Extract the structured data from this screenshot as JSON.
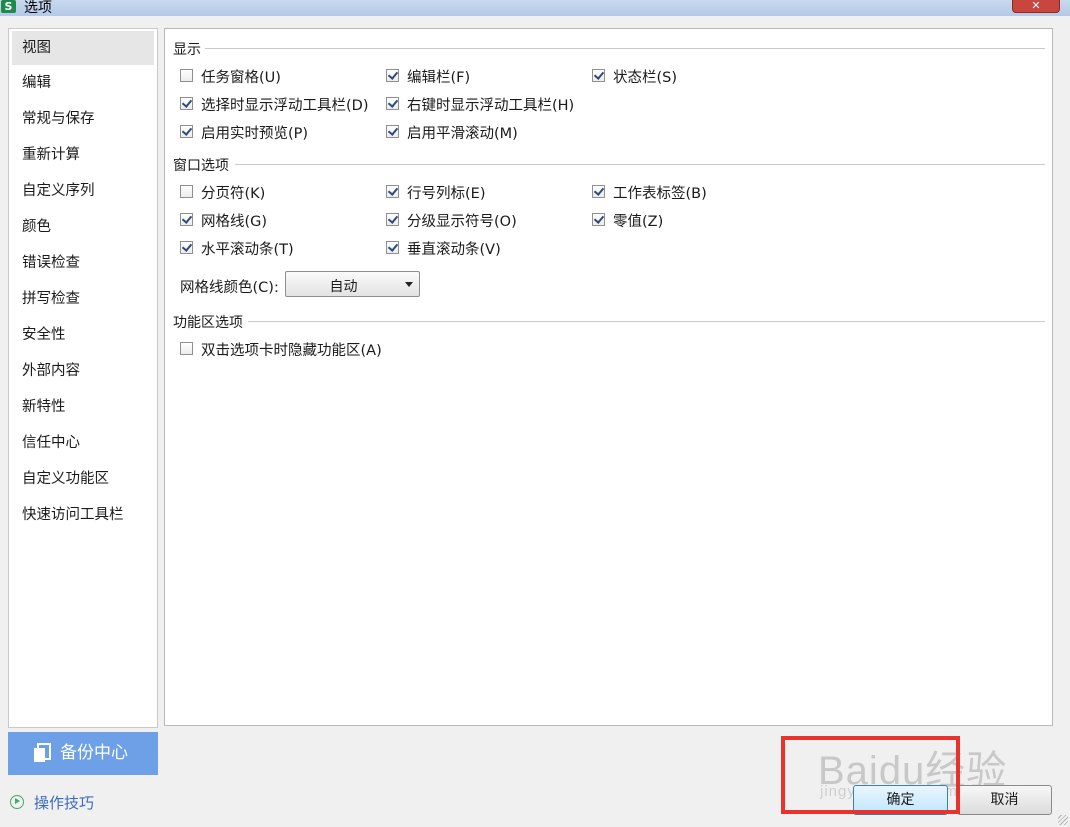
{
  "window": {
    "title": "选项",
    "app_icon": "S"
  },
  "sidebar": {
    "items": [
      {
        "label": "视图",
        "selected": true
      },
      {
        "label": "编辑"
      },
      {
        "label": "常规与保存"
      },
      {
        "label": "重新计算"
      },
      {
        "label": "自定义序列"
      },
      {
        "label": "颜色"
      },
      {
        "label": "错误检查"
      },
      {
        "label": "拼写检查"
      },
      {
        "label": "安全性"
      },
      {
        "label": "外部内容"
      },
      {
        "label": "新特性"
      },
      {
        "label": "信任中心"
      },
      {
        "label": "自定义功能区"
      },
      {
        "label": "快速访问工具栏"
      }
    ],
    "backup_label": "备份中心",
    "tips_label": "操作技巧"
  },
  "display": {
    "heading": "显示",
    "options": [
      {
        "label": "任务窗格(U)",
        "checked": false
      },
      {
        "label": "编辑栏(F)",
        "checked": true
      },
      {
        "label": "状态栏(S)",
        "checked": true
      },
      {
        "label": "选择时显示浮动工具栏(D)",
        "checked": true
      },
      {
        "label": "右键时显示浮动工具栏(H)",
        "checked": true
      },
      {
        "label": "启用实时预览(P)",
        "checked": true
      },
      {
        "label": "启用平滑滚动(M)",
        "checked": true
      }
    ]
  },
  "window_options": {
    "heading": "窗口选项",
    "options": [
      {
        "label": "分页符(K)",
        "checked": false
      },
      {
        "label": "行号列标(E)",
        "checked": true
      },
      {
        "label": "工作表标签(B)",
        "checked": true
      },
      {
        "label": "网格线(G)",
        "checked": true
      },
      {
        "label": "分级显示符号(O)",
        "checked": true
      },
      {
        "label": "零值(Z)",
        "checked": true
      },
      {
        "label": "水平滚动条(T)",
        "checked": true
      },
      {
        "label": "垂直滚动条(V)",
        "checked": true
      }
    ],
    "gridline_color_label": "网格线颜色(C):",
    "gridline_color_value": "自动"
  },
  "ribbon_options": {
    "heading": "功能区选项",
    "options": [
      {
        "label": "双击选项卡时隐藏功能区(A)",
        "checked": false
      }
    ]
  },
  "buttons": {
    "ok": "确定",
    "cancel": "取消"
  },
  "watermark": {
    "main": "Baidu经验",
    "sub": "jingyan.baidu.com"
  },
  "colors": {
    "highlight": "#e8322d",
    "backup_bg": "#6ea0e8",
    "link": "#3a6bc4"
  }
}
